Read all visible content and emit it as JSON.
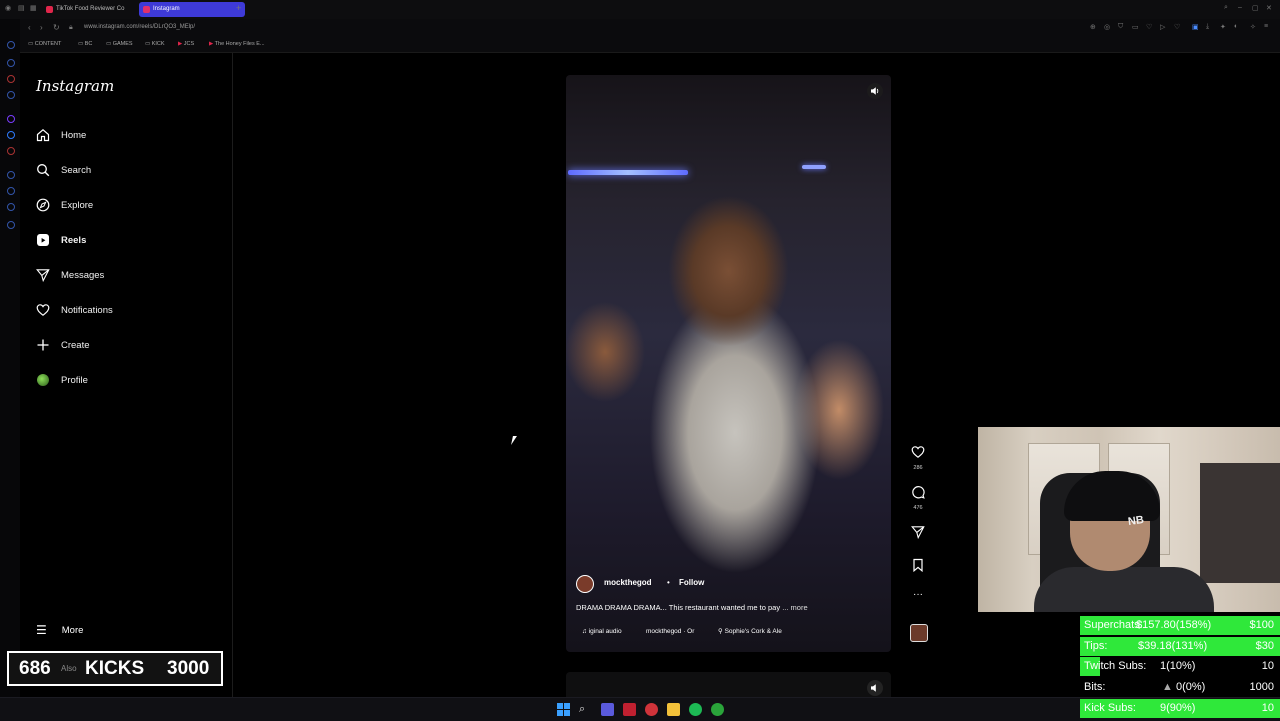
{
  "browser": {
    "tabs": [
      {
        "label": "TikTok Food Reviewer Co",
        "active": false,
        "color": "#e0264b"
      },
      {
        "label": "Instagram",
        "active": true,
        "color": "#e1306c"
      }
    ],
    "new_tab_symbol": "+",
    "url": "www.instagram.com/reels/DLrQO3_MElp/",
    "bookmarks": [
      {
        "icon": "folder-icon",
        "label": "CONTENT"
      },
      {
        "icon": "folder-icon",
        "label": "BC"
      },
      {
        "icon": "folder-icon",
        "label": "GAMES"
      },
      {
        "icon": "folder-icon",
        "label": "KICK"
      },
      {
        "icon": "youtube-icon",
        "label": "JCS"
      },
      {
        "icon": "youtube-icon",
        "label": "The Honey Files E..."
      }
    ]
  },
  "sidebar": {
    "logo": "Instagram",
    "items": [
      {
        "label": "Home",
        "icon": "home-icon"
      },
      {
        "label": "Search",
        "icon": "search-icon"
      },
      {
        "label": "Explore",
        "icon": "compass-icon"
      },
      {
        "label": "Reels",
        "icon": "reels-icon",
        "active": true
      },
      {
        "label": "Messages",
        "icon": "send-icon"
      },
      {
        "label": "Notifications",
        "icon": "heart-icon"
      },
      {
        "label": "Create",
        "icon": "plus-icon"
      },
      {
        "label": "Profile",
        "icon": "avatar-icon"
      }
    ],
    "more_label": "More"
  },
  "reel": {
    "username": "mockthegod",
    "separator": "•",
    "follow_label": "Follow",
    "caption": "DRAMA DRAMA DRAMA... This restaurant wanted me to pay",
    "more_label": "... more",
    "audio_label": "iginal audio",
    "audio_artist": "mockthegod · Or",
    "location": "Sophie's Cork & Ale",
    "likes": "286",
    "comments": "476"
  },
  "overlay": {
    "kicks_count": "686",
    "kicks_also": "Also",
    "kicks_label": "KICKS",
    "kicks_goal": "3000",
    "goals": [
      {
        "label": "Superchats:",
        "value": "$157.80(158%)",
        "target": "$100",
        "progress": 1.0
      },
      {
        "label": "Tips:",
        "value": "$39.18(131%)",
        "target": "$30",
        "progress": 1.0
      },
      {
        "label": "Twitch Subs:",
        "value": "1(10%)",
        "target": "10",
        "progress": 0.1
      },
      {
        "label": "Bits:",
        "value": "0(0%)",
        "target": "1000",
        "progress": 0.0
      },
      {
        "label": "Kick Subs:",
        "value": "9(90%)",
        "target": "10",
        "progress": 1.0
      }
    ],
    "accent": "#2fe83a"
  }
}
